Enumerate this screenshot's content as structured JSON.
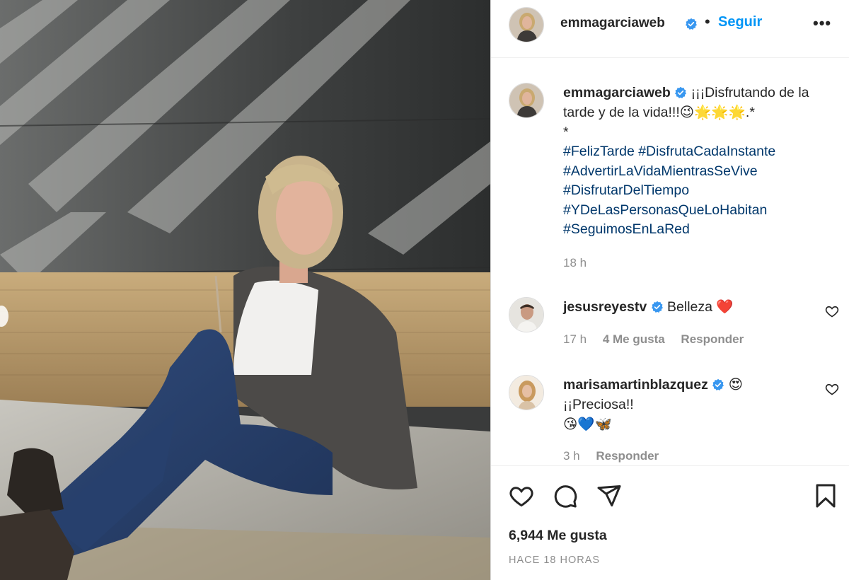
{
  "post": {
    "username": "emmagarciaweb",
    "verified": true,
    "separator": "•",
    "follow_label": "Seguir",
    "more_label": "•••",
    "caption": {
      "username": "emmagarciaweb",
      "text": "¡¡¡Disfrutando de la tarde y de la vida!!!😉🌟🌟🌟.*",
      "line2": "*",
      "hashtags": [
        "#FelizTarde #DisfrutaCadaInstante",
        "#AdvertirLaVidaMientrasSeVive",
        "#DisfrutarDelTiempo",
        "#YDeLasPersonasQueLoHabitan",
        "#SeguimosEnLaRed"
      ],
      "time": "18 h"
    },
    "comments": [
      {
        "username": "jesusreyestv",
        "text": "Belleza ❤️",
        "extra": "",
        "time": "17 h",
        "likes": "4 Me gusta",
        "reply": "Responder"
      },
      {
        "username": "marisamartinblazquez",
        "text": "😍",
        "extra": "¡¡Preciosa!!",
        "extra2": "😘💙🦋",
        "time": "3 h",
        "reply": "Responder"
      }
    ],
    "likes_label": "6,944 Me gusta",
    "posted_ago": "HACE 18 HORAS"
  },
  "icons": [
    "verified-badge-icon",
    "heart-icon",
    "comment-icon",
    "share-icon",
    "bookmark-icon",
    "more-options-icon"
  ],
  "colors": {
    "link": "#00376b",
    "follow": "#0095f6",
    "verified": "#3897f0",
    "muted": "#8e8e8e"
  }
}
